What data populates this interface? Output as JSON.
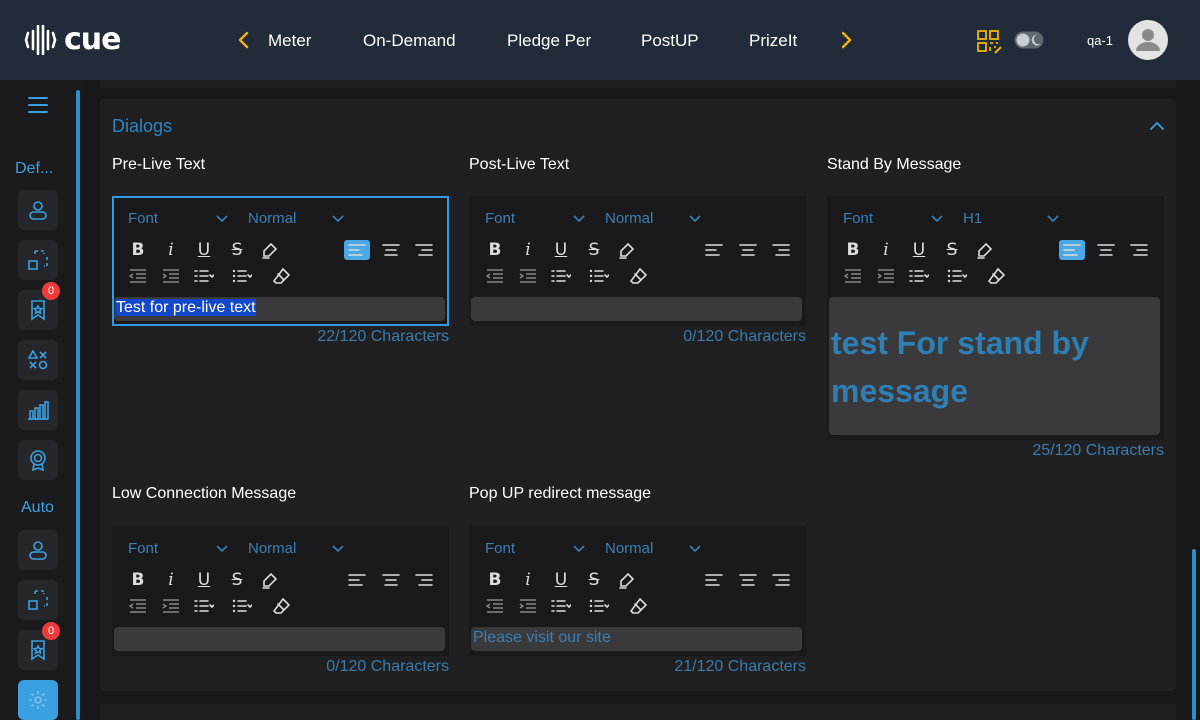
{
  "app": {
    "logo_text": "cue",
    "nav_items": [
      "Meter",
      "On-Demand",
      "Pledge Per",
      "PostUP",
      "PrizeIt"
    ],
    "username": "qa-1"
  },
  "sidebar": {
    "sections": [
      {
        "label": "Def...",
        "badge": "0"
      },
      {
        "label": "Auto",
        "badge": "0"
      }
    ]
  },
  "dialogs": {
    "title": "Dialogs",
    "toolbar": {
      "font_label": "Font"
    },
    "editors": [
      {
        "label": "Pre-Live Text",
        "size": "Normal",
        "value": "Test for pre-live text",
        "count": "22/120 Characters"
      },
      {
        "label": "Post-Live Text",
        "size": "Normal",
        "value": "",
        "count": "0/120 Characters"
      },
      {
        "label": "Stand By Message",
        "size": "H1",
        "value": " test For stand by message",
        "count": "25/120 Characters"
      },
      {
        "label": "Low Connection Message",
        "size": "Normal",
        "value": "",
        "count": "0/120 Characters"
      },
      {
        "label": "Pop UP redirect message",
        "size": "Normal",
        "value": "Please visit our site",
        "count": "21/120 Characters"
      }
    ]
  },
  "colors": {
    "accent": "#3aa0e0",
    "topbar": "#222b3a",
    "panel": "#202022",
    "badge": "#ee3b3b"
  }
}
